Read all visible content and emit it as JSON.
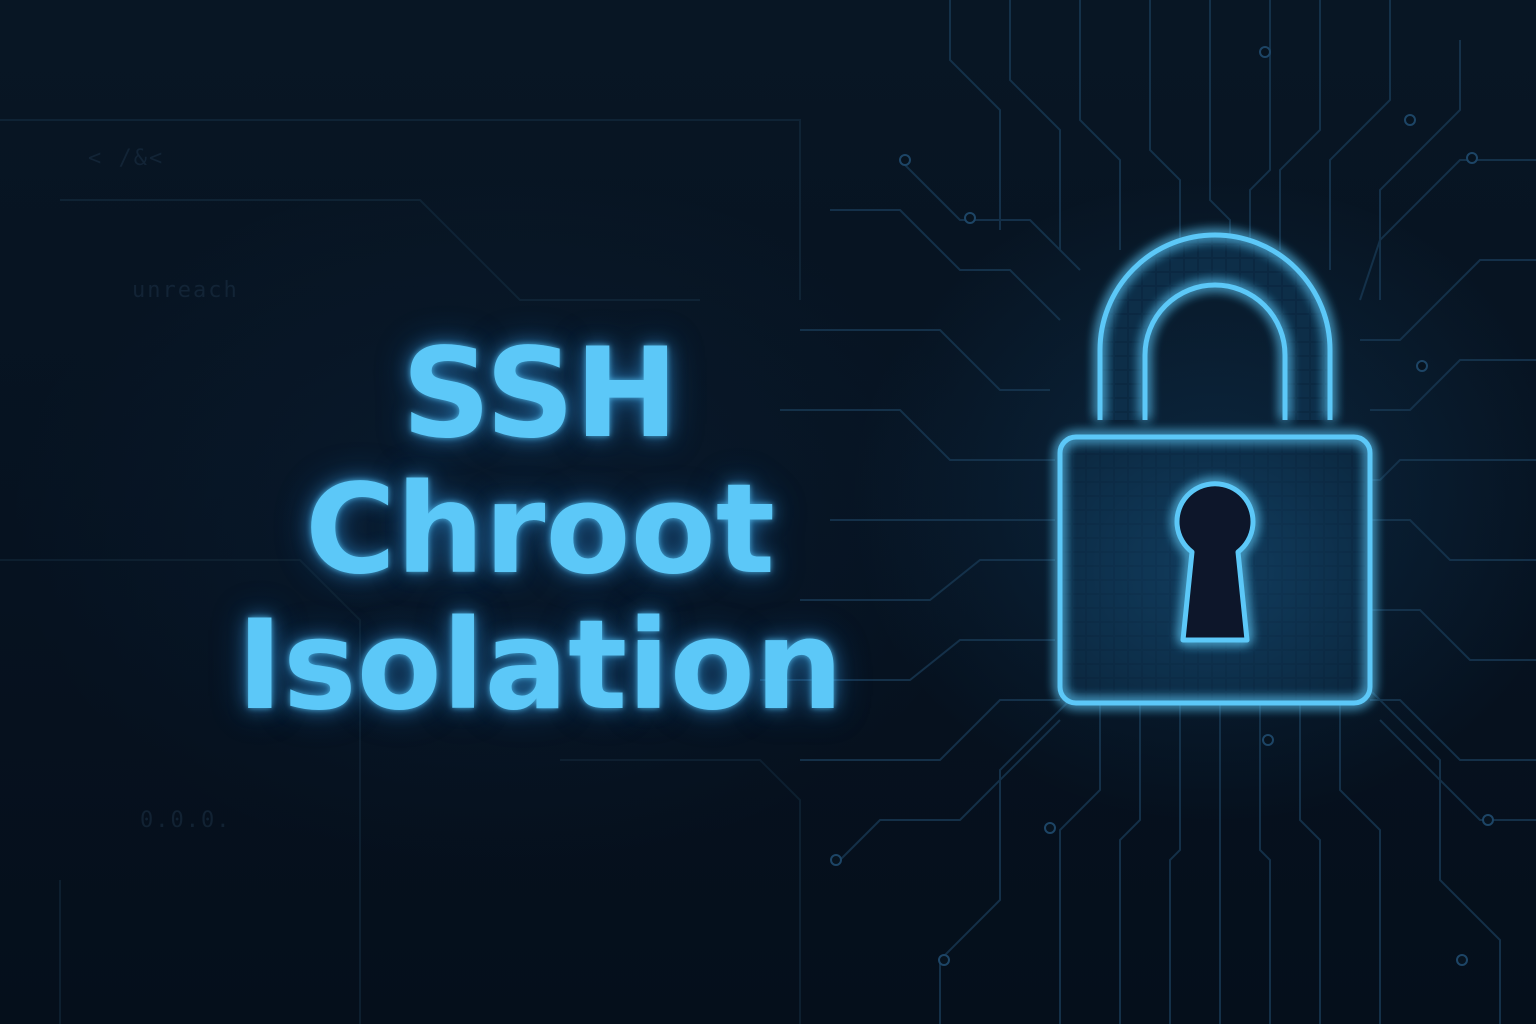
{
  "title": {
    "line1": "SSH",
    "line2": "Chroot",
    "line3": "Isolation"
  },
  "background_code": {
    "line1": "< /&<",
    "line2": "unreach",
    "line3": "0.0.0."
  },
  "icon": "padlock-icon",
  "colors": {
    "background": "#07131f",
    "accent": "#5cc8f8",
    "circuit": "#1a3a55"
  }
}
